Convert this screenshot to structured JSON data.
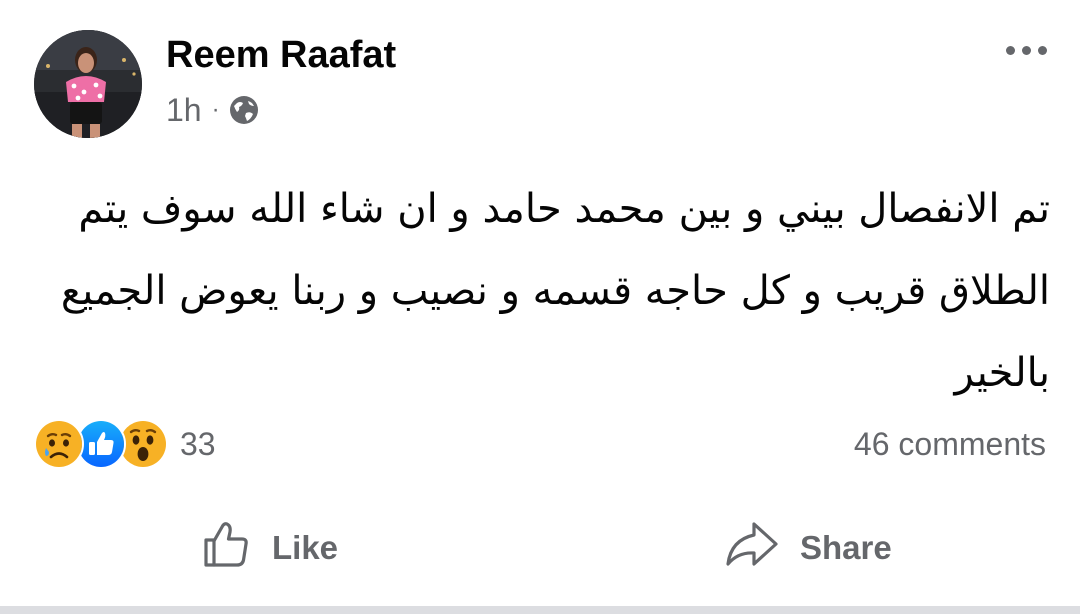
{
  "post": {
    "author": "Reem Raafat",
    "time": "1h",
    "separator": "·",
    "audience_icon": "globe-icon",
    "menu_icon": "more-horizontal-icon",
    "text": "تم الانفصال بيني و بين محمد حامد و ان شاء الله سوف يتم الطلاق قريب  و  كل حاجه قسمه و نصيب و ربنا يعوض الجميع بالخير"
  },
  "reactions": {
    "icons": [
      "sad-reaction-icon",
      "like-reaction-icon",
      "wow-reaction-icon"
    ],
    "count": "33"
  },
  "comments": {
    "label": "46 comments"
  },
  "actions": {
    "like_label": "Like",
    "like_icon": "thumbs-up-icon",
    "share_label": "Share",
    "share_icon": "share-arrow-icon"
  },
  "colors": {
    "text": "#050505",
    "secondary": "#65676b",
    "like_blue": "#1877f2",
    "reaction_yellow": "#f7b125",
    "divider": "#dcdde1"
  }
}
